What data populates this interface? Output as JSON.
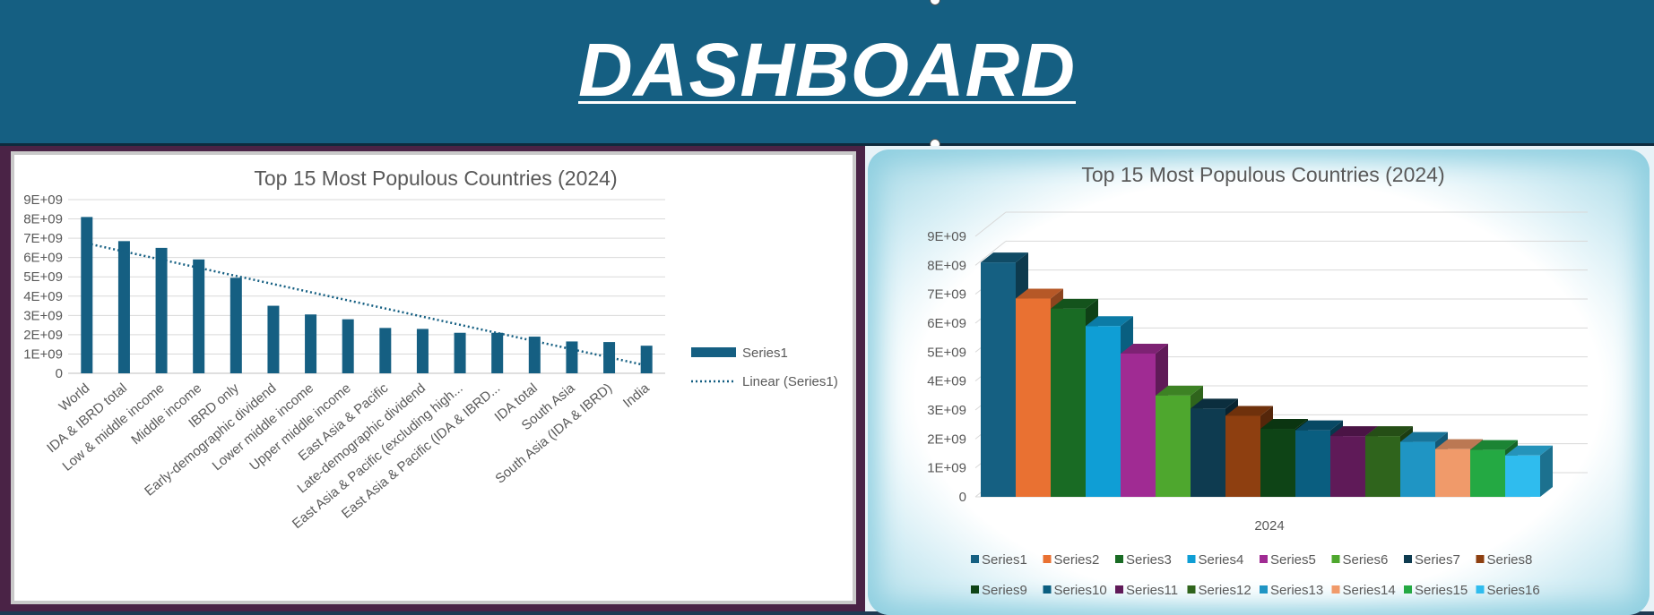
{
  "header": {
    "title": "DASHBOARD"
  },
  "colors": {
    "header_bg": "#155f82",
    "bar_primary": "#155f82",
    "trendline": "#155f82",
    "palette": [
      "#156082",
      "#e97132",
      "#196b24",
      "#0f9ed5",
      "#a02b93",
      "#4ea72e",
      "#0e3b50",
      "#8e3f10",
      "#0e4416",
      "#0a5e80",
      "#5f1a58",
      "#2f641c",
      "#1f95c4",
      "#f09a6a",
      "#24a943",
      "#2fbcee"
    ]
  },
  "chart_data": [
    {
      "type": "bar",
      "title": "Top 15 Most Populous Countries (2024)",
      "categories": [
        "World",
        "IDA & IBRD total",
        "Low & middle income",
        "Middle income",
        "IBRD only",
        "Early-demographic dividend",
        "Lower middle income",
        "Upper middle income",
        "East Asia & Pacific",
        "Late-demographic dividend",
        "East Asia & Pacific (excluding high...",
        "East Asia & Pacific (IDA & IBRD...",
        "IDA total",
        "South Asia",
        "South Asia (IDA & IBRD)",
        "India"
      ],
      "series": [
        {
          "name": "Series1",
          "values": [
            8100000000.0,
            6850000000.0,
            6500000000.0,
            5900000000.0,
            4950000000.0,
            3500000000.0,
            3050000000.0,
            2800000000.0,
            2350000000.0,
            2300000000.0,
            2100000000.0,
            2100000000.0,
            1900000000.0,
            1650000000.0,
            1620000000.0,
            1430000000.0
          ]
        }
      ],
      "trendline": {
        "name": "Linear (Series1)",
        "type": "linear",
        "style": "dotted"
      },
      "yticks": [
        "0",
        "1E+09",
        "2E+09",
        "3E+09",
        "4E+09",
        "5E+09",
        "6E+09",
        "7E+09",
        "8E+09",
        "9E+09"
      ],
      "ylim": [
        0,
        9000000000.0
      ],
      "grid": true,
      "legend": "right"
    },
    {
      "type": "bar",
      "style": "3d-clustered-column",
      "title": "Top 15 Most Populous Countries (2024)",
      "categories": [
        "2024"
      ],
      "series": [
        {
          "name": "Series1",
          "values": [
            8100000000.0
          ]
        },
        {
          "name": "Series2",
          "values": [
            6850000000.0
          ]
        },
        {
          "name": "Series3",
          "values": [
            6500000000.0
          ]
        },
        {
          "name": "Series4",
          "values": [
            5900000000.0
          ]
        },
        {
          "name": "Series5",
          "values": [
            4950000000.0
          ]
        },
        {
          "name": "Series6",
          "values": [
            3500000000.0
          ]
        },
        {
          "name": "Series7",
          "values": [
            3050000000.0
          ]
        },
        {
          "name": "Series8",
          "values": [
            2800000000.0
          ]
        },
        {
          "name": "Series9",
          "values": [
            2350000000.0
          ]
        },
        {
          "name": "Series10",
          "values": [
            2300000000.0
          ]
        },
        {
          "name": "Series11",
          "values": [
            2100000000.0
          ]
        },
        {
          "name": "Series12",
          "values": [
            2100000000.0
          ]
        },
        {
          "name": "Series13",
          "values": [
            1900000000.0
          ]
        },
        {
          "name": "Series14",
          "values": [
            1650000000.0
          ]
        },
        {
          "name": "Series15",
          "values": [
            1620000000.0
          ]
        },
        {
          "name": "Series16",
          "values": [
            1430000000.0
          ]
        }
      ],
      "yticks": [
        "0",
        "1E+09",
        "2E+09",
        "3E+09",
        "4E+09",
        "5E+09",
        "6E+09",
        "7E+09",
        "8E+09",
        "9E+09"
      ],
      "ylim": [
        0,
        9000000000.0
      ],
      "grid": true,
      "legend": "bottom"
    }
  ]
}
